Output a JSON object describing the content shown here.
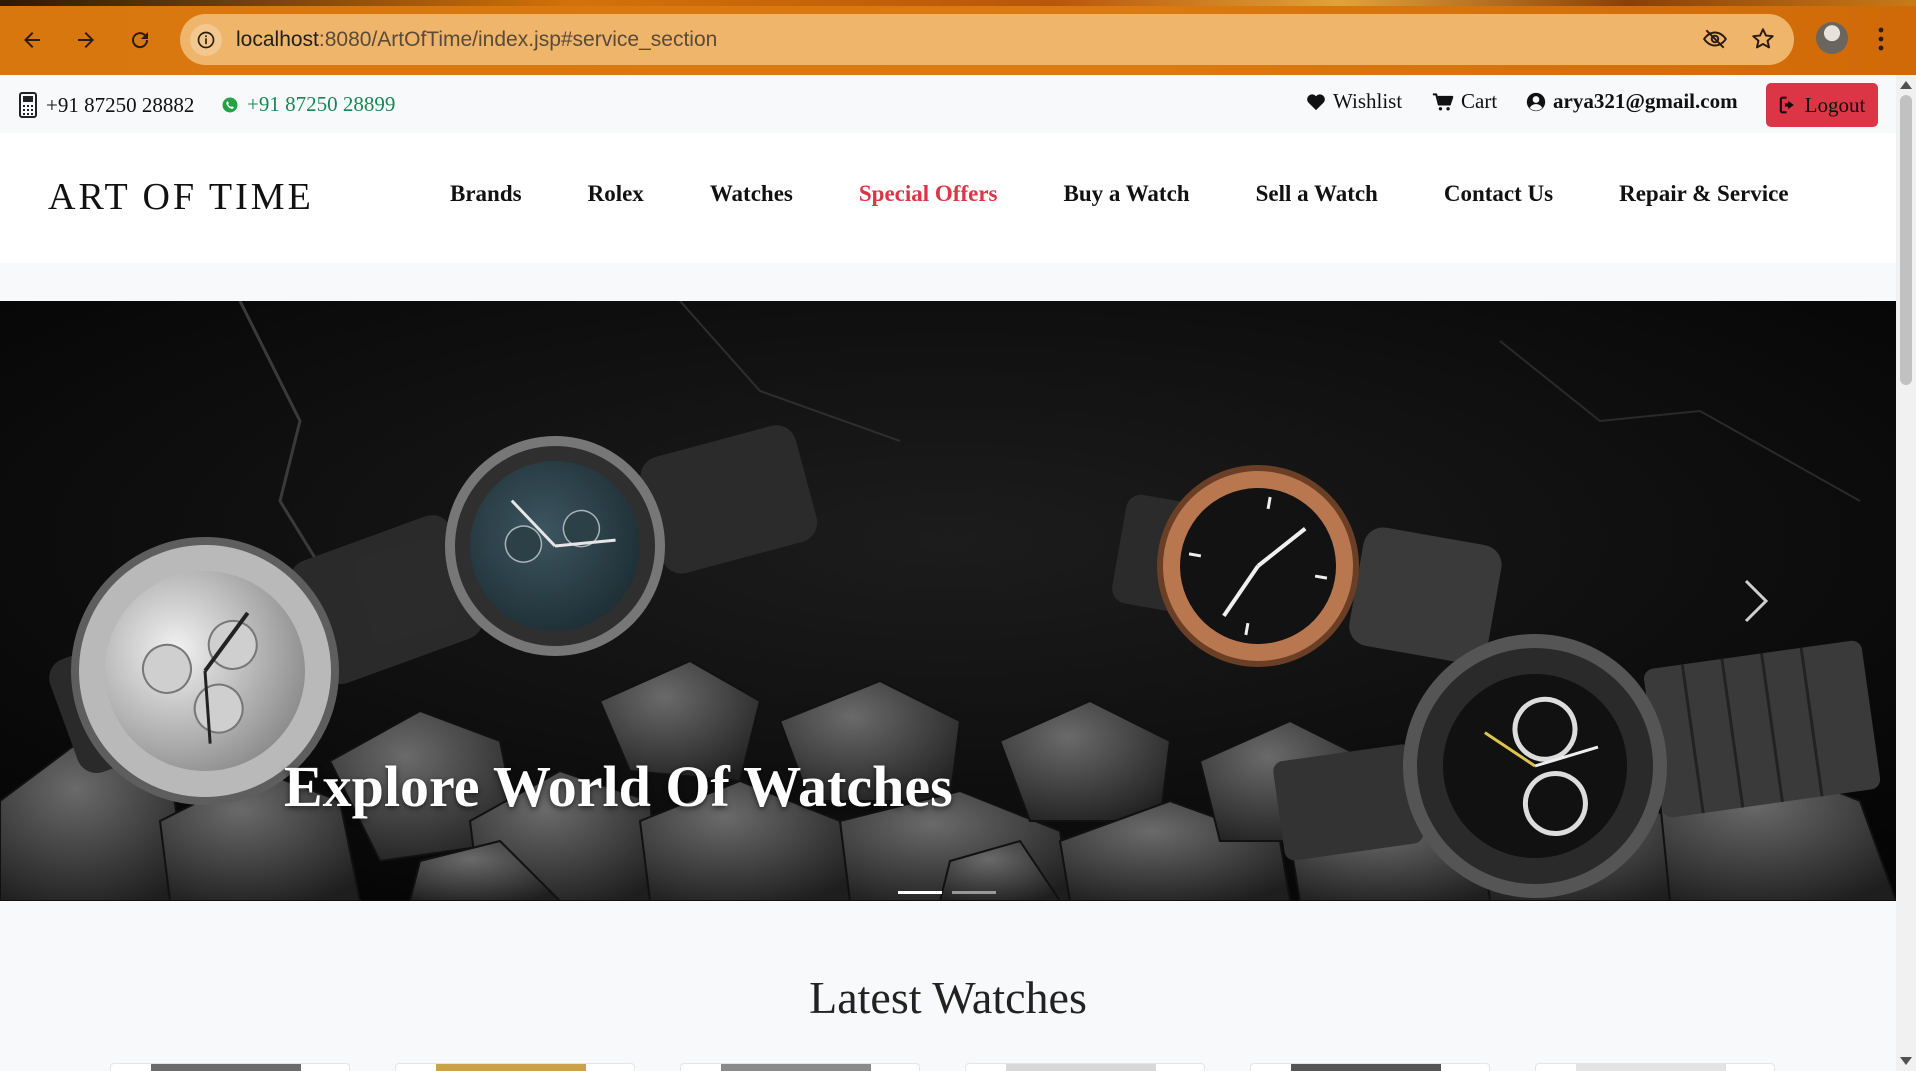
{
  "browser": {
    "url_host": "localhost",
    "url_path": ":8080/ArtOfTime/index.jsp#service_section"
  },
  "topbar": {
    "phone": "+91 87250 28882",
    "whatsapp": "+91 87250 28899",
    "wishlist": "Wishlist",
    "cart": "Cart",
    "user_email": "arya321@gmail.com",
    "logout": "Logout"
  },
  "nav": {
    "logo": "ART OF TIME",
    "links": [
      "Brands",
      "Rolex",
      "Watches",
      "Special Offers",
      "Buy a Watch",
      "Sell a Watch",
      "Contact Us",
      "Repair & Service"
    ],
    "active": "Special Offers"
  },
  "hero": {
    "caption": "Explore World Of Watches",
    "slides": 2,
    "active_slide": 1
  },
  "latest": {
    "title": "Latest Watches"
  },
  "colors": {
    "accent_red": "#dc3545",
    "whatsapp_green": "#198754",
    "chrome_orange": "#d9770f"
  },
  "icons": [
    "back-icon",
    "forward-icon",
    "reload-icon",
    "info-icon",
    "eye-off-icon",
    "star-icon",
    "phone-icon",
    "whatsapp-icon",
    "heart-icon",
    "cart-icon",
    "user-circle-icon",
    "logout-icon",
    "chevron-right-icon"
  ]
}
